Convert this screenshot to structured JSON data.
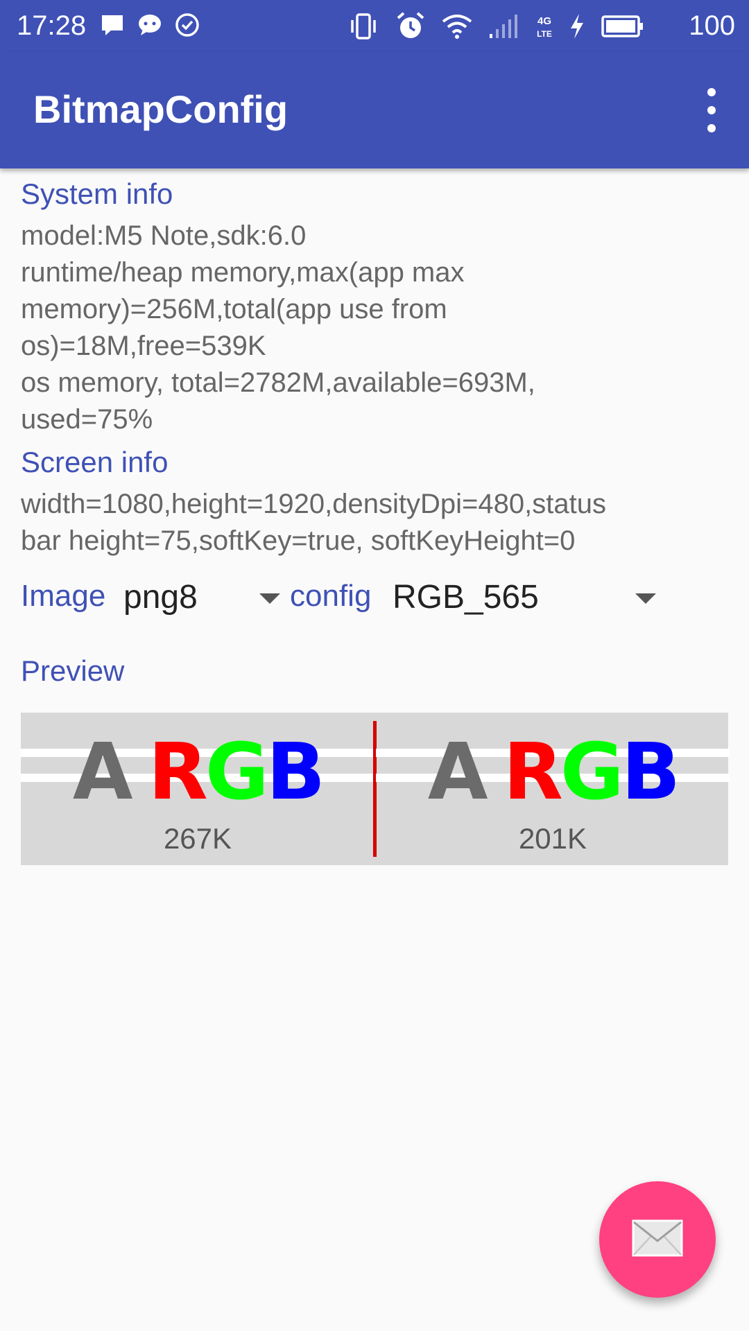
{
  "status_bar": {
    "time": "17:28",
    "battery_level": "100",
    "left_icons": [
      "message-icon",
      "chat-icon",
      "check-circle-icon"
    ],
    "right_icons": [
      "vibrate-icon",
      "alarm-icon",
      "wifi-icon",
      "signal-icon",
      "4g-lte-icon",
      "charging-icon",
      "battery-icon"
    ]
  },
  "app_bar": {
    "title": "BitmapConfig",
    "menu_icon": "overflow-menu-icon"
  },
  "system_info": {
    "heading": "System info",
    "text": "model:M5 Note,sdk:6.0\nruntime/heap memory,max(app max\nmemory)=256M,total(app use from\nos)=18M,free=539K\nos memory, total=2782M,available=693M,\nused=75%"
  },
  "screen_info": {
    "heading": "Screen info",
    "text": "width=1080,height=1920,densityDpi=480,status\nbar height=75,softKey=true, softKeyHeight=0"
  },
  "selectors": {
    "image_label": "Image",
    "image_value": "png8",
    "config_label": "config",
    "config_value": "RGB_565"
  },
  "preview": {
    "heading": "Preview",
    "left": {
      "letters": [
        "A",
        "R",
        "G",
        "B"
      ],
      "size": "267K"
    },
    "right": {
      "letters": [
        "A",
        "R",
        "G",
        "B"
      ],
      "size": "201K"
    }
  },
  "fab": {
    "icon": "mail-icon"
  },
  "colors": {
    "primary": "#3f51b5",
    "accent": "#ff4081",
    "divider": "#d50000",
    "letter_a": "#6b6b6b",
    "letter_r": "#ff0000",
    "letter_g": "#00ff00",
    "letter_b": "#0000ff"
  }
}
